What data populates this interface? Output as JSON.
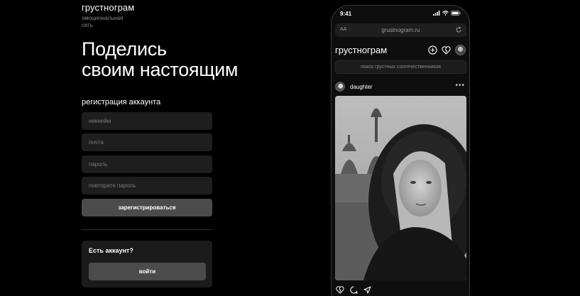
{
  "brand": {
    "name": "грустнограм",
    "tagline_1": "эмоциональная",
    "tagline_2": "сеть"
  },
  "hero": {
    "line1": "Поделись",
    "line2": "своим настоящим"
  },
  "registration": {
    "title": "регистрация аккаунта",
    "nickname_placeholder": "никнейм",
    "email_placeholder": "почта",
    "password_placeholder": "пароль",
    "repeat_password_placeholder": "повторите пароль",
    "submit_label": "зарегистрироваться"
  },
  "login": {
    "question": "Есть аккаунт?",
    "button_label": "войти"
  },
  "phone": {
    "status_time": "9:41",
    "browser": {
      "aa_label": "AA",
      "url": "grustnogram.ru"
    },
    "app_title": "грустнограм",
    "search_placeholder": "поиск грустных соотечественников",
    "post": {
      "username": "daughter",
      "more_label": "•••"
    }
  },
  "icons": {
    "add": "plus-circle-icon",
    "broken_heart": "broken-heart-icon",
    "profile": "avatar",
    "reload": "reload-icon",
    "comment": "comment-icon",
    "share": "send-icon"
  },
  "colors": {
    "background": "#000000",
    "field_bg": "#1e1e1e",
    "button_bg": "#4b4b4b",
    "muted_text": "#7c7c7c"
  }
}
